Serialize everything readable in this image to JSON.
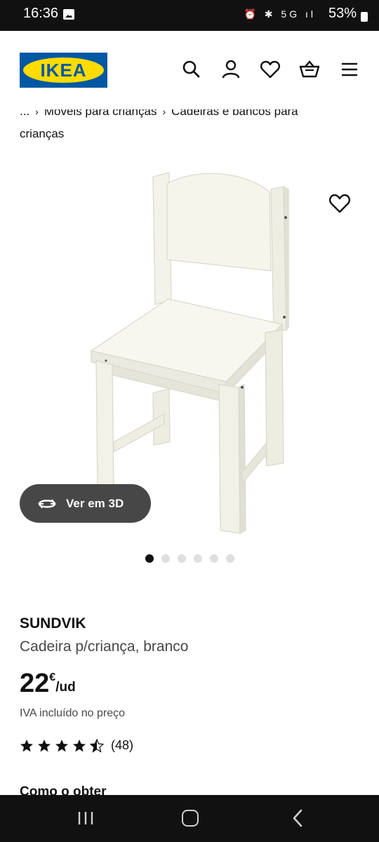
{
  "status_bar": {
    "time": "16:36",
    "icons": "⏰ ✱ 5G ıl",
    "battery": "53%"
  },
  "header": {
    "logo_text": "IKEA",
    "icons": [
      "search-icon",
      "profile-icon",
      "wishlist-icon",
      "cart-icon",
      "menu-icon"
    ],
    "colors": {
      "logo_blue": "#0058a3",
      "logo_yellow": "#ffdb00"
    }
  },
  "breadcrumb": {
    "ellipsis": "...",
    "item1": "Móveis para crianças",
    "item2": "Cadeiras e bancos para",
    "item2_cont": "crianças"
  },
  "gallery": {
    "view3d_label": "Ver em 3D",
    "dot_count": 6,
    "active_index": 0
  },
  "product": {
    "name": "SUNDVIK",
    "description": "Cadeira p/criança, branco",
    "price_int": "22",
    "currency": "€",
    "unit": "/ud",
    "vat_note": "IVA incluído no preço",
    "rating_value": 4.5,
    "rating_count": "(48)"
  },
  "section": {
    "how_to_get": "Como o obter"
  }
}
